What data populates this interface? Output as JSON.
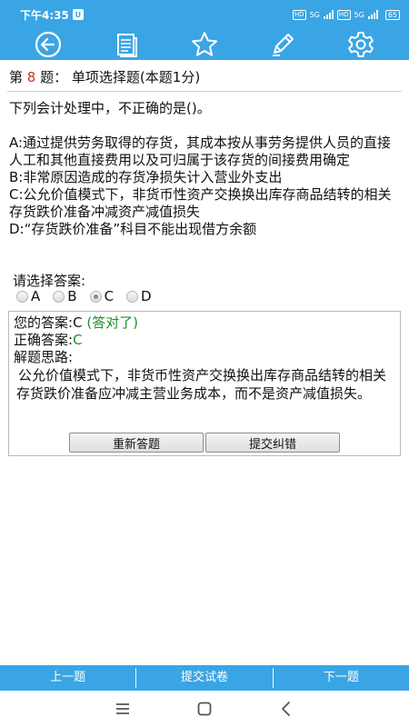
{
  "status_bar": {
    "time": "下午4:35",
    "badge": "U",
    "hd1": "HD",
    "net1": "5G",
    "hd2": "HD",
    "net2": "5G",
    "battery": "65"
  },
  "toolbar": {
    "icons": [
      "back-icon",
      "notes-icon",
      "star-icon",
      "pencil-icon",
      "gear-icon"
    ]
  },
  "question": {
    "prefix": "第",
    "number": "8",
    "suffix": "题：",
    "type": "单项选择题(本题1分)",
    "stem": "下列会计处理中，不正确的是()。",
    "options": [
      "A:通过提供劳务取得的存货，其成本按从事劳务提供人员的直接人工和其他直接费用以及可归属于该存货的间接费用确定",
      "B:非常原因造成的存货净损失计入营业外支出",
      "C:公允价值模式下，非货币性资产交换换出库存商品结转的相关存货跌价准备冲减资产减值损失",
      "D:“存货跌价准备”科目不能出现借方余额"
    ]
  },
  "answer_select": {
    "label": "请选择答案:",
    "choices": [
      "A",
      "B",
      "C",
      "D"
    ],
    "selected": "C"
  },
  "result": {
    "your_answer_label": "您的答案:",
    "your_answer": "C",
    "verdict": " (答对了)",
    "correct_label": "正确答案:",
    "correct_answer": "C",
    "analysis_label": "解题思路:",
    "analysis": "公允价值模式下，非货币性资产交换换出库存商品结转的相关存货跌价准备应冲减主营业务成本，而不是资产减值损失。",
    "redo_button": "重新答题",
    "report_button": "提交纠错"
  },
  "bottom_bar": {
    "prev": "上一题",
    "submit": "提交试卷",
    "next": "下一题"
  },
  "colors": {
    "accent": "#3aa5e5",
    "question_number": "#c0392b",
    "correct": "#1e8e2e"
  }
}
